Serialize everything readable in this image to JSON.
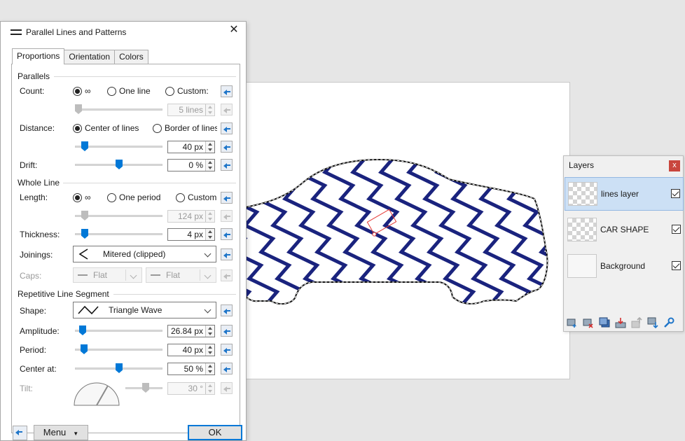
{
  "dialog": {
    "title": "Parallel Lines and Patterns",
    "close": "✕",
    "tabs": [
      "Proportions",
      "Orientation",
      "Colors"
    ]
  },
  "parallels": {
    "header": "Parallels",
    "count": {
      "label": "Count:",
      "options": [
        "∞",
        "One line",
        "Custom:"
      ],
      "selected": "∞",
      "lines_value": "5 lines",
      "slider_level": 0.0
    },
    "distance": {
      "label": "Distance:",
      "options": [
        "Center of lines",
        "Border of lines"
      ],
      "selected": "Center of lines",
      "value": "40 px",
      "slider_level": 0.08
    },
    "drift": {
      "label": "Drift:",
      "value": "0 %",
      "slider_level": 0.5
    }
  },
  "whole_line": {
    "header": "Whole Line",
    "length": {
      "label": "Length:",
      "options": [
        "∞",
        "One period",
        "Custom"
      ],
      "selected": "∞",
      "value": "124 px",
      "slider_level": 0.08
    },
    "thickness": {
      "label": "Thickness:",
      "value": "4 px",
      "slider_level": 0.08
    },
    "joinings": {
      "label": "Joinings:",
      "value": "Mitered (clipped)"
    },
    "caps": {
      "label": "Caps:",
      "start": "Flat",
      "end": "Flat"
    }
  },
  "segment": {
    "header": "Repetitive Line Segment",
    "shape": {
      "label": "Shape:",
      "value": "Triangle Wave"
    },
    "amplitude": {
      "label": "Amplitude:",
      "value": "26.84 px",
      "slider_level": 0.05
    },
    "period": {
      "label": "Period:",
      "value": "40 px",
      "slider_level": 0.07
    },
    "center_at": {
      "label": "Center at:",
      "value": "50 %",
      "slider_level": 0.5
    },
    "tilt": {
      "label": "Tilt:",
      "value": "30 °",
      "slider_level": 0.55
    }
  },
  "footer": {
    "menu": "Menu",
    "ok": "OK"
  },
  "layers": {
    "title": "Layers",
    "close": "x",
    "items": [
      {
        "name": "lines layer",
        "selected": true,
        "visible": true
      },
      {
        "name": "CAR SHAPE",
        "selected": false,
        "visible": true
      },
      {
        "name": "Background",
        "selected": false,
        "visible": true
      }
    ]
  },
  "colors": {
    "wave": "#1a237e",
    "accent": "#0078d7",
    "selection_marker": "#e53935"
  }
}
